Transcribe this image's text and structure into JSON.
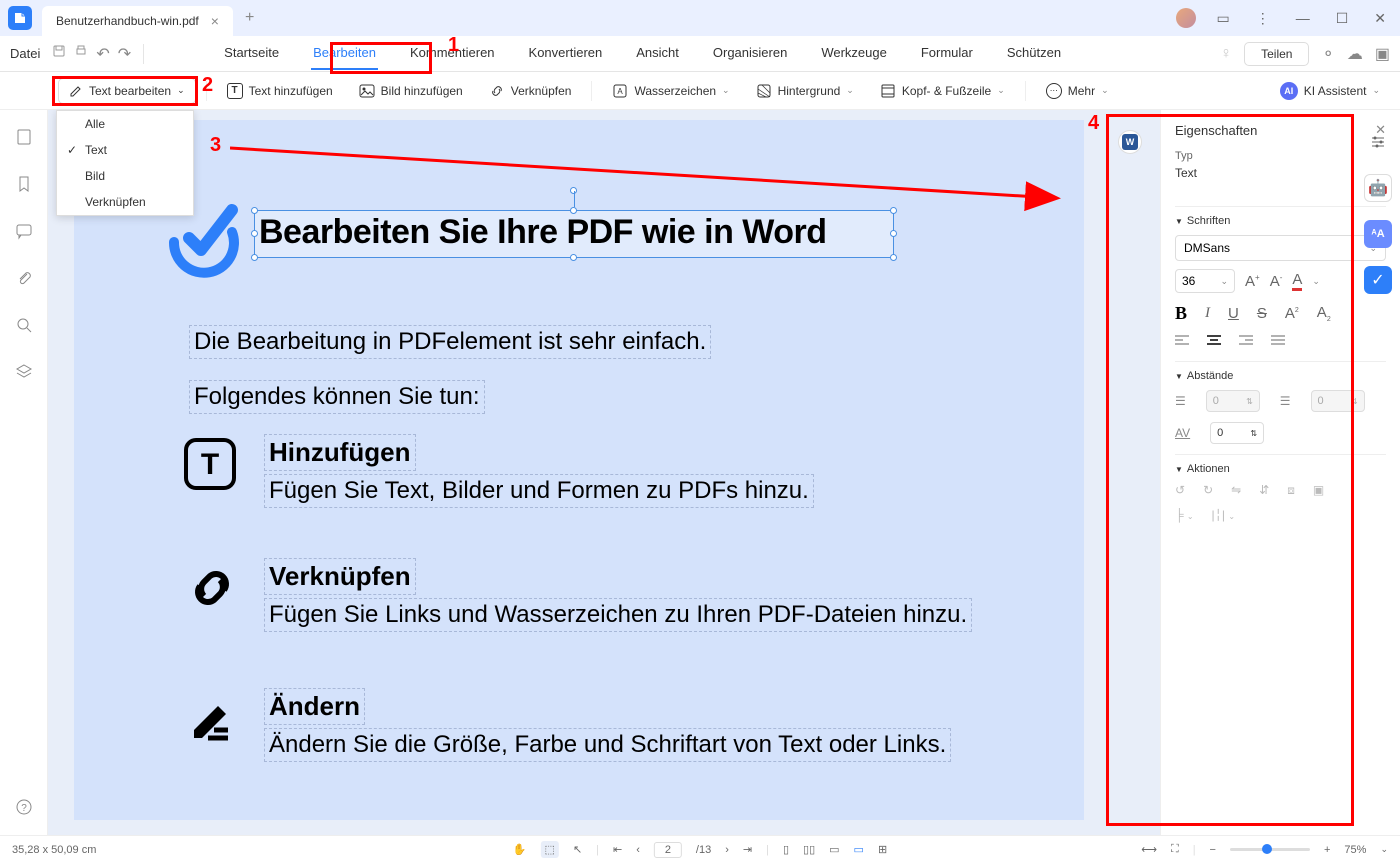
{
  "titlebar": {
    "doc_name": "Benutzerhandbuch-win.pdf"
  },
  "menubar": {
    "file": "Datei",
    "tabs": [
      "Startseite",
      "Bearbeiten",
      "Kommentieren",
      "Konvertieren",
      "Ansicht",
      "Organisieren",
      "Werkzeuge",
      "Formular",
      "Schützen"
    ],
    "active_index": 1,
    "share": "Teilen"
  },
  "toolbar": {
    "edit_text": "Text bearbeiten",
    "add_text": "Text hinzufügen",
    "add_image": "Bild hinzufügen",
    "link": "Verknüpfen",
    "watermark": "Wasserzeichen",
    "background": "Hintergrund",
    "header_footer": "Kopf- & Fußzeile",
    "more": "Mehr",
    "ai_assistant": "KI Assistent"
  },
  "dropdown": {
    "items": [
      "Alle",
      "Text",
      "Bild",
      "Verknüpfen"
    ],
    "checked_index": 1
  },
  "page_content": {
    "title": "Bearbeiten Sie Ihre PDF wie in Word",
    "intro": "Die Bearbeitung in PDFelement ist sehr einfach.",
    "subintro": "Folgendes können Sie tun:",
    "feat1_title": "Hinzufügen",
    "feat1_desc": "Fügen Sie Text, Bilder und Formen zu PDFs hinzu.",
    "feat2_title": "Verknüpfen",
    "feat2_desc": "Fügen Sie Links und Wasserzeichen zu Ihren PDF-Dateien hinzu.",
    "feat3_title": "Ändern",
    "feat3_desc": "Ändern Sie die Größe, Farbe und Schriftart von Text oder Links."
  },
  "properties": {
    "title": "Eigenschaften",
    "type_label": "Typ",
    "type_value": "Text",
    "fonts_header": "Schriften",
    "font_name": "DMSans",
    "font_size": "36",
    "spacing_header": "Abstände",
    "line_spacing": "0",
    "para_spacing": "0",
    "char_spacing": "0",
    "actions_header": "Aktionen"
  },
  "statusbar": {
    "dimensions": "35,28 x 50,09 cm",
    "page_current": "2",
    "page_total": "/13",
    "zoom": "75%"
  },
  "annotations": {
    "n1": "1",
    "n2": "2",
    "n3": "3",
    "n4": "4"
  }
}
